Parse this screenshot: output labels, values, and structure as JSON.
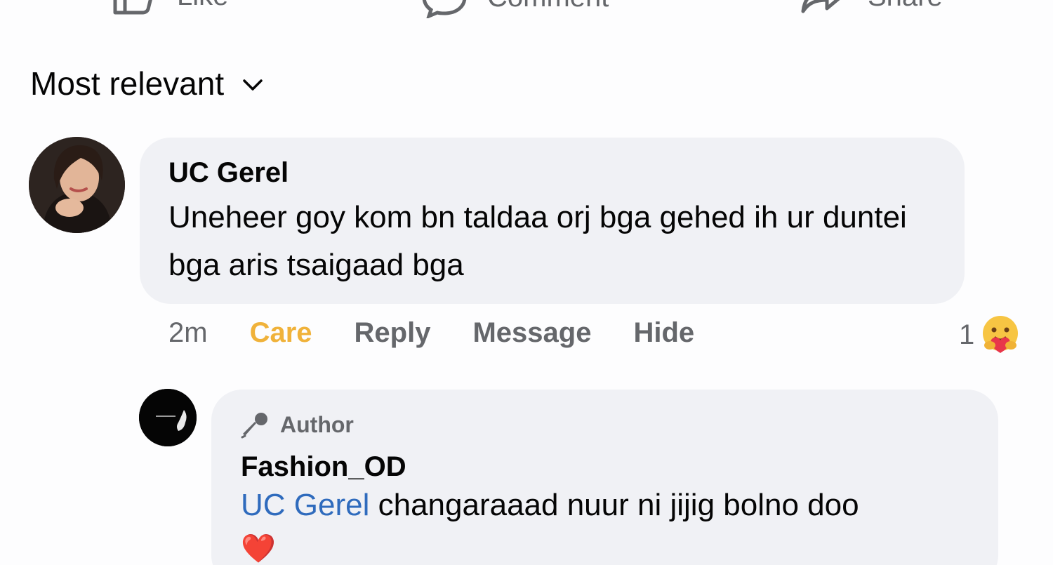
{
  "actions": {
    "like_label": "Like",
    "comment_label": "Comment",
    "share_label": "Share"
  },
  "sort": {
    "label": "Most relevant"
  },
  "comment": {
    "author": "UC Gerel",
    "text": "Uneheer goy kom bn taldaa orj bga gehed ih ur duntei bga aris tsaigaad bga",
    "time": "2m",
    "reaction_label": "Care",
    "reply_label": "Reply",
    "message_label": "Message",
    "hide_label": "Hide",
    "reaction_count": "1",
    "reaction_icon": "care-emoji-icon"
  },
  "reply": {
    "badge": "Author",
    "author": "Fashion_OD",
    "mention": "UC Gerel",
    "text": " changaraaad nuur ni jijig bolno doo",
    "emoji": "❤️"
  },
  "colors": {
    "care": "#f0b23a",
    "mention": "#2f6bbd",
    "secondary_text": "#65676b",
    "bubble": "#f0f1f5"
  }
}
